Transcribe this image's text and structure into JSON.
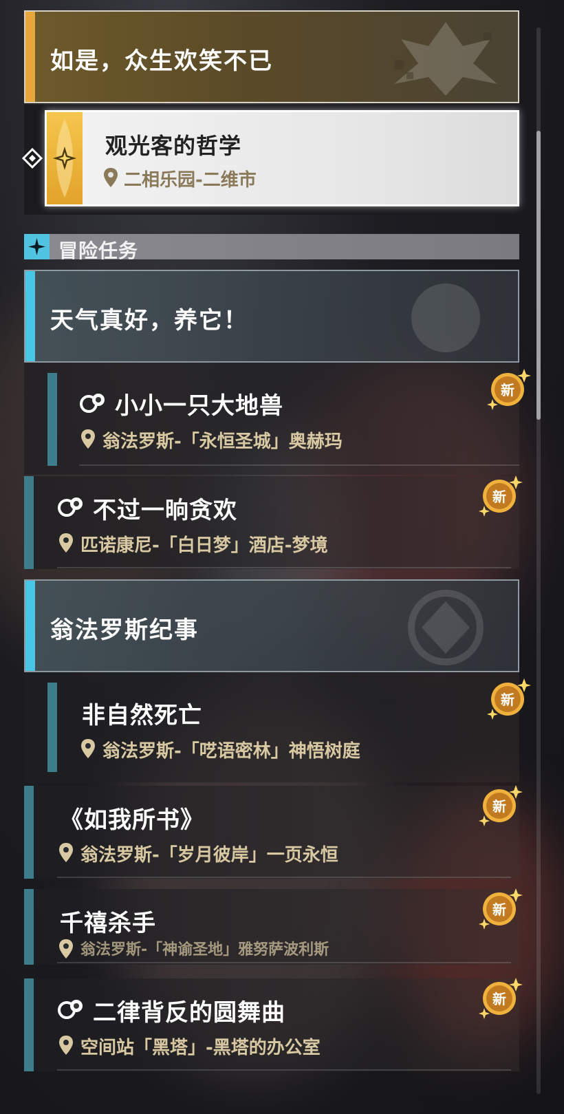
{
  "current_group": {
    "title": "如是，众生欢笑不已",
    "selected_quest": {
      "title": "观光客的哲学",
      "location": "二相乐园-二维市"
    }
  },
  "section": {
    "label": "冒险任务",
    "icon": "four-point-star-icon"
  },
  "categories": [
    {
      "title": "天气真好，养它！",
      "quests": [
        {
          "title": "小小一只大地兽",
          "location": "翁法罗斯-「永恒圣城」奥赫玛",
          "badge": "新",
          "icon": "trailblaze-icon"
        },
        {
          "title": "不过一晌贪欢",
          "location": "匹诺康尼-「白日梦」酒店-梦境",
          "badge": "新",
          "icon": "trailblaze-icon"
        }
      ]
    },
    {
      "title": "翁法罗斯纪事",
      "quests": [
        {
          "title": "非自然死亡",
          "location": "翁法罗斯-「呓语密林」神悟树庭",
          "badge": "新"
        },
        {
          "title": "《如我所书》",
          "location": "翁法罗斯-「岁月彼岸」一页永恒",
          "badge": "新"
        },
        {
          "title": "千禧杀手",
          "location": "翁法罗斯-「神谕圣地」雅努萨波利斯",
          "badge": "新"
        },
        {
          "title": "二律背反的圆舞曲",
          "location": "空间站「黑塔」-黑塔的办公室",
          "badge": "新",
          "icon": "trailblaze-icon"
        }
      ]
    }
  ],
  "colors": {
    "gold_accent": "#e8a73a",
    "cyan_accent": "#48c6e6",
    "quest_bar": "#3d7d8c",
    "location_text": "#d8c9a3",
    "badge": "#f0b23c"
  }
}
